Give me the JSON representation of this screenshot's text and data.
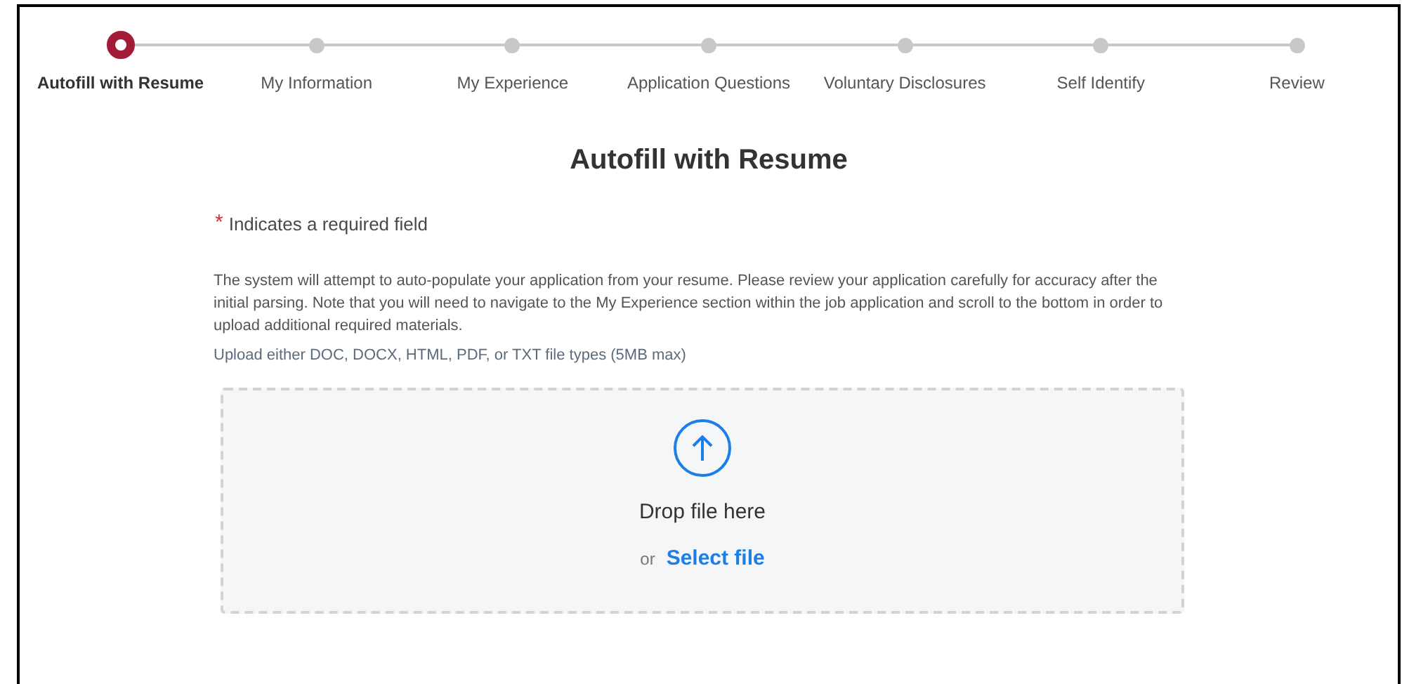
{
  "steps": [
    {
      "label": "Autofill with Resume",
      "selected": true
    },
    {
      "label": "My Information",
      "selected": false
    },
    {
      "label": "My Experience",
      "selected": false
    },
    {
      "label": "Application Questions",
      "selected": false
    },
    {
      "label": "Voluntary Disclosures",
      "selected": false
    },
    {
      "label": "Self Identify",
      "selected": false
    },
    {
      "label": "Review",
      "selected": false
    }
  ],
  "heading": "Autofill with Resume",
  "required_note": {
    "mark": "*",
    "text": "Indicates a required field"
  },
  "description": "The system will attempt to auto-populate your application from your resume. Please review your application carefully for accuracy after the initial parsing. Note that you will need to navigate to the My Experience section within the job application and scroll to the bottom in order to upload additional required materials.",
  "file_types_note": "Upload either DOC, DOCX, HTML, PDF, or TXT file types (5MB max)",
  "dropzone": {
    "prompt": "Drop file here",
    "or": "or",
    "link": "Select file"
  }
}
